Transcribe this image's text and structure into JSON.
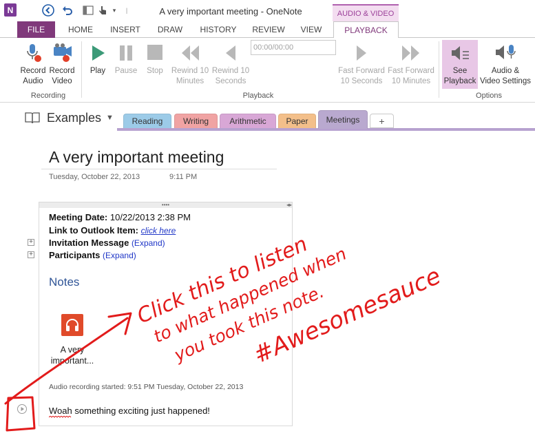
{
  "app": {
    "window_title": "A very important meeting - OneNote",
    "logo": "N"
  },
  "quick_access": [
    "back-icon",
    "undo-icon",
    "dock-icon",
    "touch-mode-icon",
    "customize-icon"
  ],
  "ribbon": {
    "context_tab_header": "AUDIO & VIDEO",
    "tabs": [
      "FILE",
      "HOME",
      "INSERT",
      "DRAW",
      "HISTORY",
      "REVIEW",
      "VIEW",
      "PLAYBACK"
    ],
    "active_tab": "PLAYBACK",
    "groups": {
      "recording": {
        "label": "Recording",
        "buttons": [
          {
            "l1": "Record",
            "l2": "Audio",
            "icon": "microphone-icon",
            "enabled": true
          },
          {
            "l1": "Record",
            "l2": "Video",
            "icon": "video-camera-icon",
            "enabled": true
          }
        ]
      },
      "playback": {
        "label": "Playback",
        "time": "00:00/00:00",
        "buttons": [
          {
            "l1": "Play",
            "l2": "",
            "icon": "play-icon",
            "enabled": true
          },
          {
            "l1": "Pause",
            "l2": "",
            "icon": "pause-icon",
            "enabled": false
          },
          {
            "l1": "Stop",
            "l2": "",
            "icon": "stop-icon",
            "enabled": false
          },
          {
            "l1": "Rewind 10",
            "l2": "Minutes",
            "icon": "rewind-icon",
            "enabled": false
          },
          {
            "l1": "Rewind 10",
            "l2": "Seconds",
            "icon": "rewind-seconds-icon",
            "enabled": false
          },
          {
            "l1": "Fast Forward",
            "l2": "10 Seconds",
            "icon": "fast-forward-seconds-icon",
            "enabled": false
          },
          {
            "l1": "Fast Forward",
            "l2": "10 Minutes",
            "icon": "fast-forward-icon",
            "enabled": false
          }
        ]
      },
      "options": {
        "label": "Options",
        "buttons": [
          {
            "l1": "See",
            "l2": "Playback",
            "icon": "see-playback-icon",
            "enabled": true,
            "selected": true
          },
          {
            "l1": "Audio &",
            "l2": "Video Settings",
            "icon": "audio-settings-icon",
            "enabled": true
          }
        ]
      }
    }
  },
  "notebook": {
    "name": "Examples",
    "sections": [
      {
        "label": "Reading",
        "color": "#9ccbe8"
      },
      {
        "label": "Writing",
        "color": "#f0a3a3"
      },
      {
        "label": "Arithmetic",
        "color": "#d8a7d6"
      },
      {
        "label": "Paper",
        "color": "#f3bf8a"
      },
      {
        "label": "Meetings",
        "color": "#b9a9cf",
        "active": true
      }
    ],
    "add_tab": "+"
  },
  "page": {
    "title": "A very important meeting",
    "date": "Tuesday, October 22, 2013",
    "time": "9:11 PM",
    "note": {
      "meeting_date_label": "Meeting Date:",
      "meeting_date_value": "10/22/2013 2:38 PM",
      "outlook_label": "Link to Outlook Item:",
      "outlook_link": "click here",
      "invitation_label": "Invitation Message",
      "participants_label": "Participants",
      "expand": "(Expand)",
      "notes_heading": "Notes",
      "audio_file_label_1": "A very",
      "audio_file_label_2": "important...",
      "audio_started": "Audio recording started: 9:51 PM Tuesday, October 22, 2013",
      "body_text": "Woah something exciting just happened!"
    }
  },
  "annotation": {
    "color": "#e21b1b",
    "line1": "Click this to listen",
    "line2": "to what happened when",
    "line3": "you took this note.",
    "line4": "#Awesomesauce"
  }
}
